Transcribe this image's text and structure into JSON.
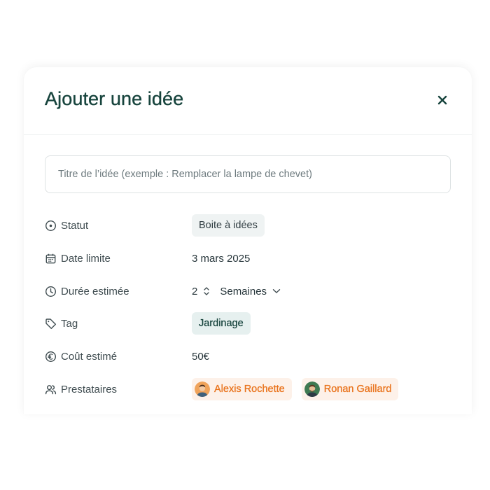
{
  "modal": {
    "title": "Ajouter une idée",
    "close_icon": "close-icon"
  },
  "form": {
    "title_placeholder": "Titre de l’idée (exemple : Remplacer la lampe de chevet)",
    "title_value": ""
  },
  "fields": {
    "status": {
      "label": "Statut",
      "icon": "status-circle-icon",
      "value": "Boite à idées"
    },
    "deadline": {
      "label": "Date limite",
      "icon": "calendar-icon",
      "value": "3 mars 2025"
    },
    "duration": {
      "label": "Durée estimée",
      "icon": "clock-icon",
      "amount": "2",
      "unit": "Semaines"
    },
    "tag": {
      "label": "Tag",
      "icon": "tag-icon",
      "value": "Jardinage"
    },
    "cost": {
      "label": "Coût estimé",
      "icon": "euro-icon",
      "value": "50€"
    },
    "providers": {
      "label": "Prestataires",
      "icon": "users-icon",
      "people": [
        {
          "name": "Alexis Rochette"
        },
        {
          "name": "Ronan Gaillard"
        }
      ]
    }
  },
  "colors": {
    "title": "#17443d",
    "tag_bg": "#e6f0ef",
    "status_bg": "#eff3f3",
    "person_bg": "#fdf1e9",
    "person_text": "#e9731c"
  }
}
